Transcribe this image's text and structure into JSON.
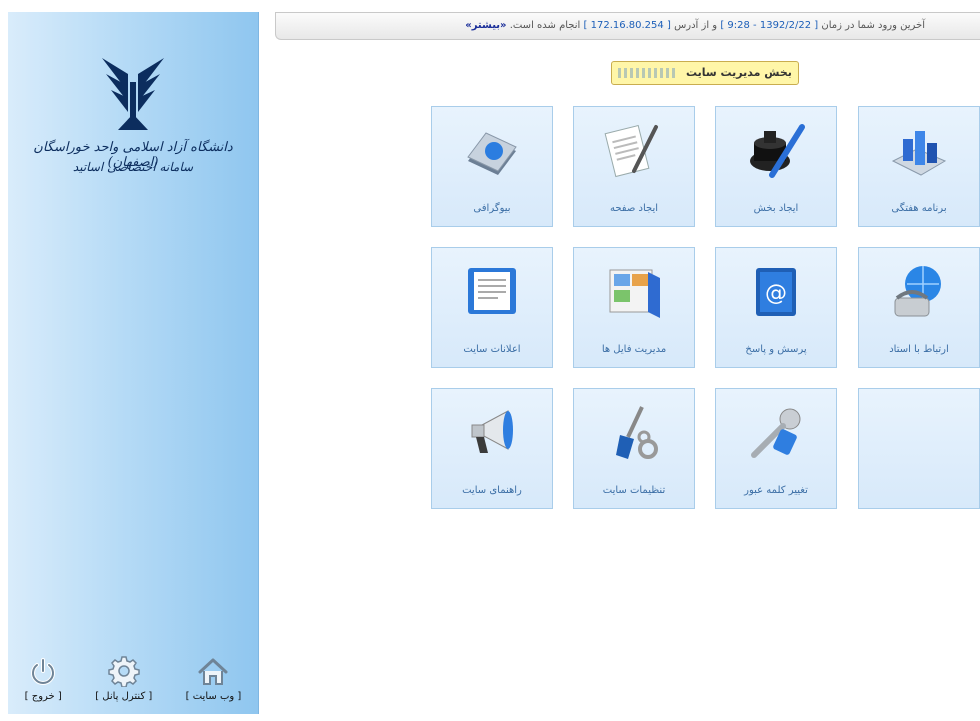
{
  "sidebar": {
    "logo_line1": "دانشگاه آزاد اسلامی واحد خوراسگان (اصفهان)",
    "logo_line2": "سامانه اختصاصی اساتید",
    "links": [
      {
        "label": "[ وب سایت ]",
        "icon": "home-icon"
      },
      {
        "label": "[ کنترل پانل ]",
        "icon": "gear-icon"
      },
      {
        "label": "[ خروج ]",
        "icon": "power-icon"
      }
    ]
  },
  "topbar": {
    "prefix": "آخرین ورود شما در زمان",
    "datetime": "[ 1392/2/22 - 9:28 ]",
    "mid": "و از آدرس",
    "ip": "[ 172.16.80.254 ]",
    "suffix": "انجام شده است.",
    "more": "«بیشتر»"
  },
  "title": "بخش مدیریت سایت",
  "tiles": [
    {
      "label": "برنامه هفتگی",
      "icon": "weekly-schedule-icon"
    },
    {
      "label": "ایجاد بخش",
      "icon": "ink-pen-icon"
    },
    {
      "label": "ایجاد صفحه",
      "icon": "document-pen-icon"
    },
    {
      "label": "بیوگرافی",
      "icon": "biography-book-icon"
    },
    {
      "label": "ارتباط با استاد",
      "icon": "globe-phone-icon"
    },
    {
      "label": "پرسش و پاسخ",
      "icon": "address-book-icon"
    },
    {
      "label": "مدیریت فایل ها",
      "icon": "file-folder-icon"
    },
    {
      "label": "اعلانات سایت",
      "icon": "announcement-book-icon"
    },
    {
      "label": "",
      "icon": ""
    },
    {
      "label": "تغییر کلمه عبور",
      "icon": "keys-icon"
    },
    {
      "label": "تنظیمات سایت",
      "icon": "tools-icon"
    },
    {
      "label": "راهنمای سایت",
      "icon": "megaphone-icon"
    }
  ],
  "colors": {
    "accent": "#3b6ea5",
    "sidebar": "#b6dbf6",
    "tile": "#dcebfa"
  }
}
